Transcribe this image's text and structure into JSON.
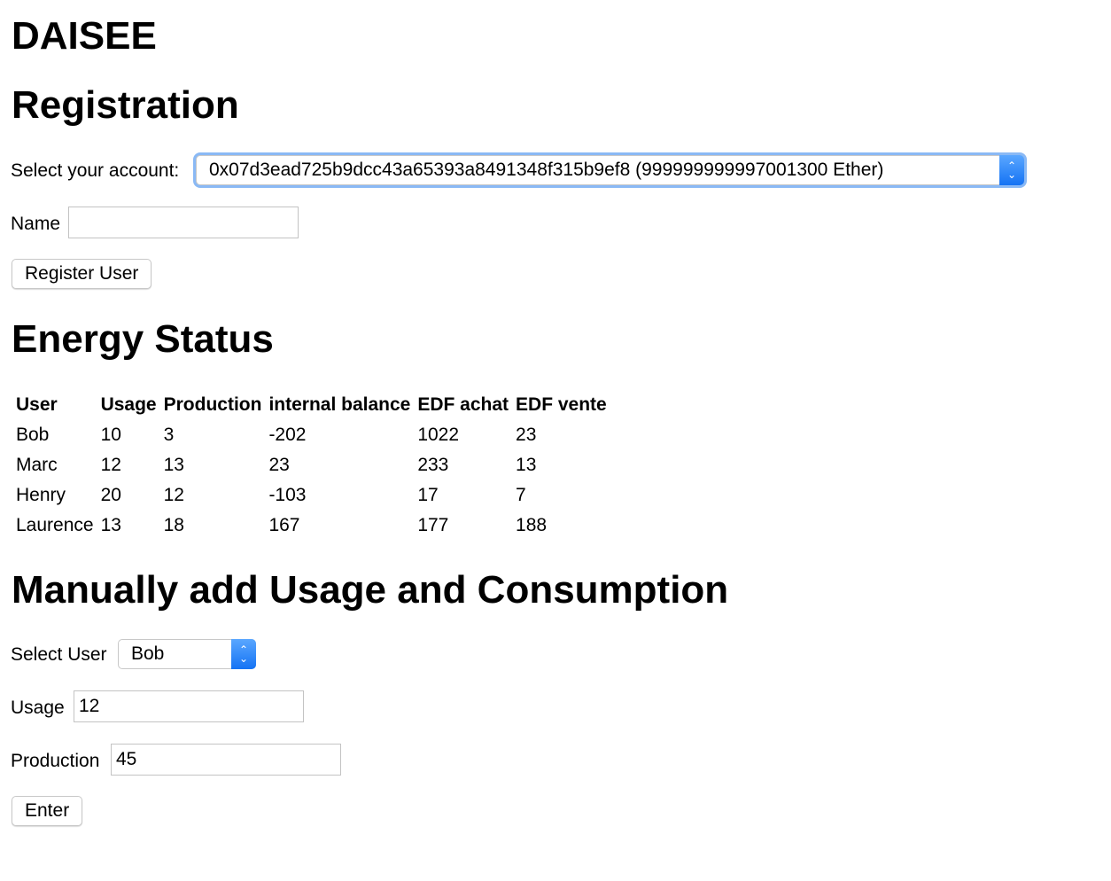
{
  "title": "DAISEE",
  "registration": {
    "heading": "Registration",
    "account_label": "Select your account:",
    "account_value": "0x07d3ead725b9dcc43a65393a8491348f315b9ef8 (999999999997001300 Ether)",
    "name_label": "Name",
    "name_value": "",
    "register_button": "Register User"
  },
  "energy": {
    "heading": "Energy Status",
    "columns": [
      "User",
      "Usage",
      "Production",
      "internal balance",
      "EDF achat",
      "EDF vente"
    ],
    "rows": [
      [
        "Bob",
        "10",
        "3",
        "-202",
        "1022",
        "23"
      ],
      [
        "Marc",
        "12",
        "13",
        "23",
        "233",
        "13"
      ],
      [
        "Henry",
        "20",
        "12",
        "-103",
        "17",
        "7"
      ],
      [
        "Laurence",
        "13",
        "18",
        "167",
        "177",
        "188"
      ]
    ]
  },
  "manual": {
    "heading": "Manually add Usage and Consumption",
    "user_label": "Select User",
    "user_value": "Bob",
    "usage_label": "Usage",
    "usage_value": "12",
    "production_label": "Production",
    "production_value": "45",
    "enter_button": "Enter"
  }
}
